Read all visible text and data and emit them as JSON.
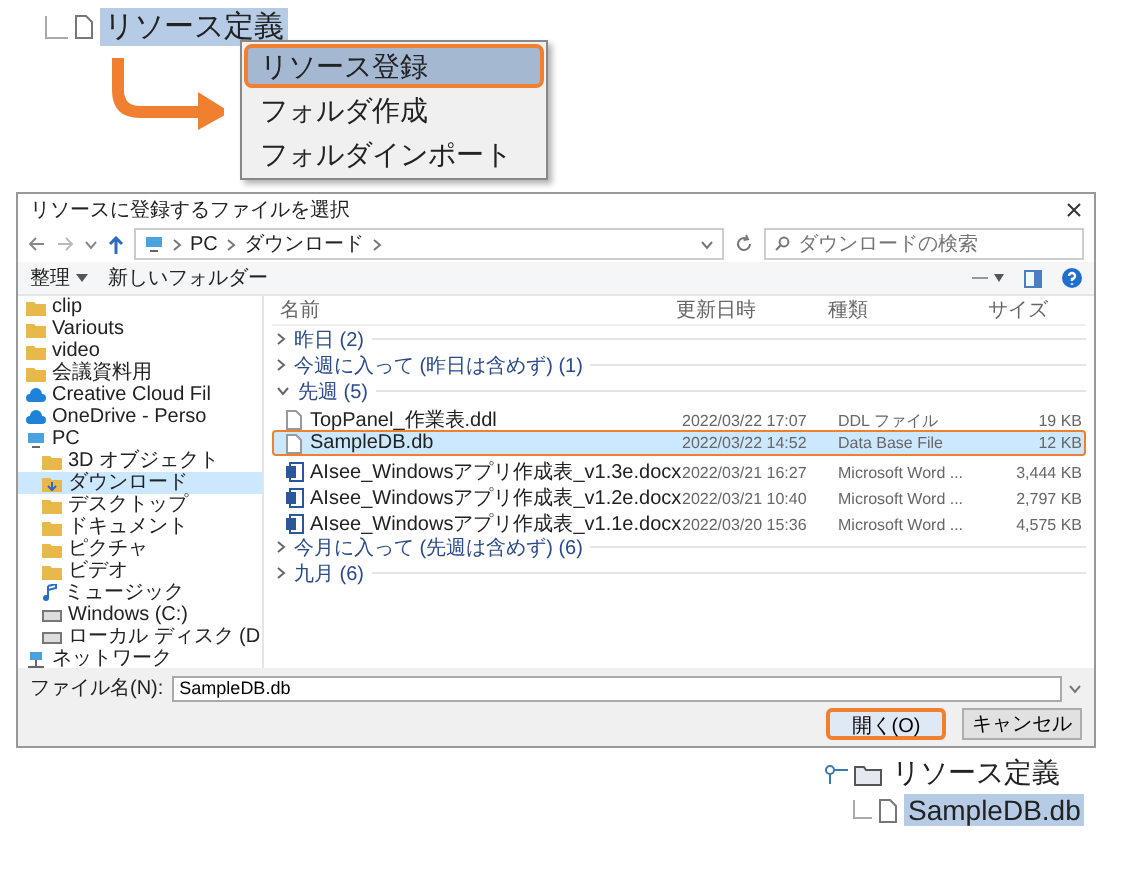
{
  "resource_tree_top": {
    "label": "リソース定義",
    "selected": true
  },
  "context_menu": {
    "items": [
      {
        "label": "リソース登録",
        "selected": true
      },
      {
        "label": "フォルダ作成",
        "selected": false
      },
      {
        "label": "フォルダインポート",
        "selected": false
      }
    ]
  },
  "dialog": {
    "title": "リソースに登録するファイルを選択",
    "breadcrumbs": [
      "PC",
      "ダウンロード"
    ],
    "search": {
      "placeholder": "ダウンロードの検索"
    },
    "toolbar": [
      "整理",
      "新しいフォルダー"
    ],
    "sidebar": [
      {
        "label": "clip",
        "kind": "folder",
        "selected": false
      },
      {
        "label": "Variouts",
        "kind": "folder",
        "selected": false
      },
      {
        "label": "video",
        "kind": "folder",
        "selected": false
      },
      {
        "label": "会議資料用",
        "kind": "folder",
        "selected": false
      },
      {
        "label": "Creative Cloud Fil",
        "kind": "cloud",
        "selected": false
      },
      {
        "label": "OneDrive - Perso",
        "kind": "cloud",
        "selected": false
      },
      {
        "label": "PC",
        "kind": "pc",
        "selected": false,
        "children": [
          {
            "label": "3D オブジェクト",
            "kind": "folder",
            "selected": false
          },
          {
            "label": "ダウンロード",
            "kind": "download",
            "selected": true
          },
          {
            "label": "デスクトップ",
            "kind": "folder",
            "selected": false
          },
          {
            "label": "ドキュメント",
            "kind": "folder",
            "selected": false
          },
          {
            "label": "ピクチャ",
            "kind": "folder",
            "selected": false
          },
          {
            "label": "ビデオ",
            "kind": "folder",
            "selected": false
          },
          {
            "label": "ミュージック",
            "kind": "music",
            "selected": false
          },
          {
            "label": "Windows (C:)",
            "kind": "drive",
            "selected": false
          },
          {
            "label": "ローカル ディスク (D",
            "kind": "drive",
            "selected": false
          }
        ]
      },
      {
        "label": "ネットワーク",
        "kind": "network",
        "selected": false
      }
    ],
    "columns": [
      "名前",
      "更新日時",
      "種類",
      "サイズ"
    ],
    "groups": [
      {
        "label": "昨日 (2)",
        "expanded": false
      },
      {
        "label": "今週に入って (昨日は含めず) (1)",
        "expanded": false
      },
      {
        "label": "先週 (5)",
        "expanded": true,
        "files": [
          {
            "name": "TopPanel_作業表.ddl",
            "date": "2022/03/22 17:07",
            "type": "DDL ファイル",
            "size": "19 KB",
            "kind": "file",
            "selected": false
          },
          {
            "name": "SampleDB.db",
            "date": "2022/03/22 14:52",
            "type": "Data Base File",
            "size": "12 KB",
            "kind": "file",
            "selected": true
          },
          {
            "name": "AIsee_Windowsアプリ作成表_v1.3e.docx",
            "date": "2022/03/21 16:27",
            "type": "Microsoft Word ...",
            "size": "3,444 KB",
            "kind": "word",
            "selected": false
          },
          {
            "name": "AIsee_Windowsアプリ作成表_v1.2e.docx",
            "date": "2022/03/21 10:40",
            "type": "Microsoft Word ...",
            "size": "2,797 KB",
            "kind": "word",
            "selected": false
          },
          {
            "name": "AIsee_Windowsアプリ作成表_v1.1e.docx",
            "date": "2022/03/20 15:36",
            "type": "Microsoft Word ...",
            "size": "4,575 KB",
            "kind": "word",
            "selected": false
          }
        ]
      },
      {
        "label": "今月に入って (先週は含めず) (6)",
        "expanded": false
      },
      {
        "label": "九月 (6)",
        "expanded": false
      }
    ],
    "filename": {
      "label": "ファイル名(N):",
      "value": "SampleDB.db"
    },
    "buttons": [
      {
        "label": "開く(O)",
        "selected": true
      },
      {
        "label": "キャンセル",
        "selected": false
      }
    ]
  },
  "resource_tree_bottom": {
    "label": "リソース定義",
    "children": [
      {
        "label": "SampleDB.db",
        "selected": true
      }
    ]
  }
}
